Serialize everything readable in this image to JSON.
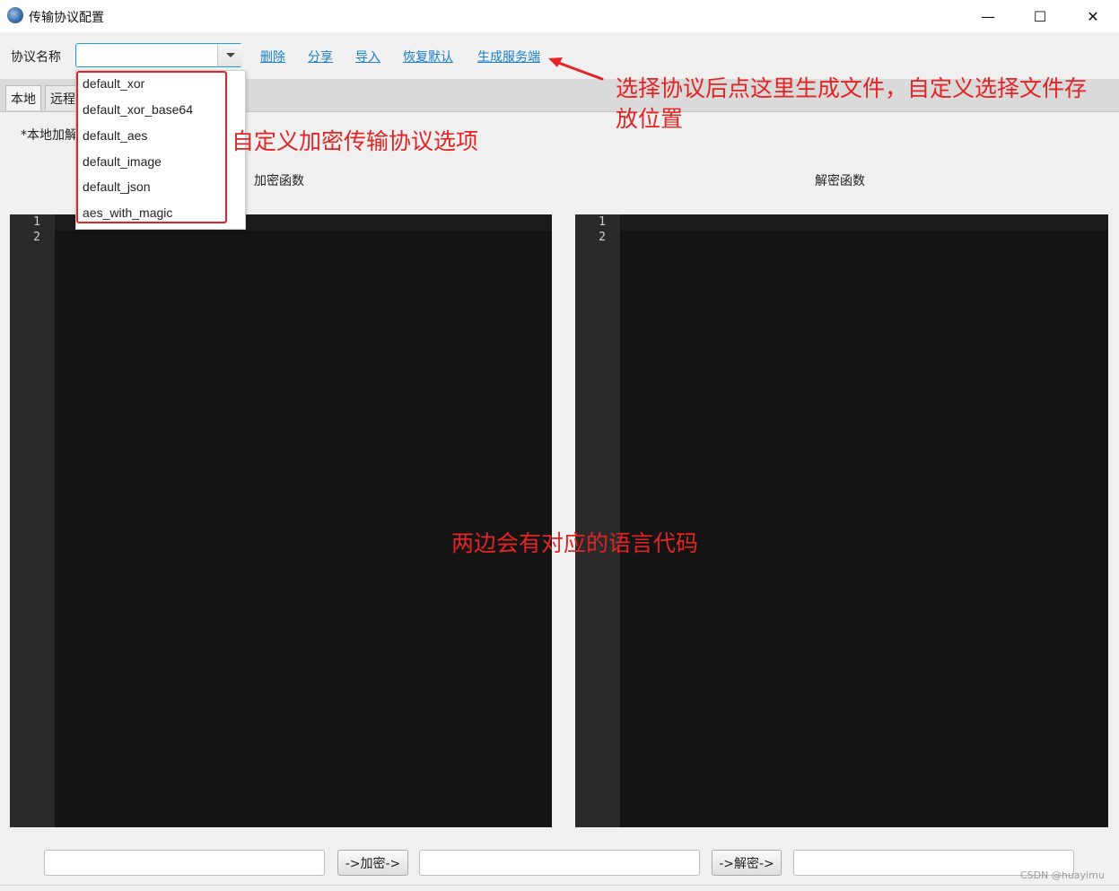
{
  "window": {
    "title": "传输协议配置",
    "minimize_glyph": "—",
    "maximize_glyph": "☐",
    "close_glyph": "✕"
  },
  "toolbar": {
    "protocol_label": "协议名称",
    "combo_value": "",
    "links": {
      "delete": "删除",
      "share": "分享",
      "import": "导入",
      "restore": "恢复默认",
      "generate": "生成服务端"
    }
  },
  "dropdown": {
    "options": [
      "default_xor",
      "default_xor_base64",
      "default_aes",
      "default_image",
      "default_json",
      "aes_with_magic"
    ]
  },
  "tabs": [
    "本地",
    "远程"
  ],
  "local_note": "*本地加解",
  "panels": {
    "encrypt_title": "加密函数",
    "decrypt_title": "解密函数",
    "line_numbers": [
      "1",
      "2"
    ]
  },
  "bottom": {
    "plain_input": "",
    "encrypt_button": "->加密->",
    "encrypted_output": "",
    "decrypt_button": "->解密->",
    "decrypted_output": ""
  },
  "annotations": {
    "options_note": "自定义加密传输协议选项",
    "generate_note": "选择协议后点这里生成文件，自定义选择文件存放位置",
    "middle_note": "两边会有对应的语言代码"
  },
  "watermark": "CSDN @huayimu",
  "colors": {
    "accent_link": "#1a7fc8",
    "combo_border": "#1a9fdf",
    "annotation_red": "#e32424",
    "editor_bg": "#141414",
    "gutter_bg": "#2a2a2a"
  }
}
